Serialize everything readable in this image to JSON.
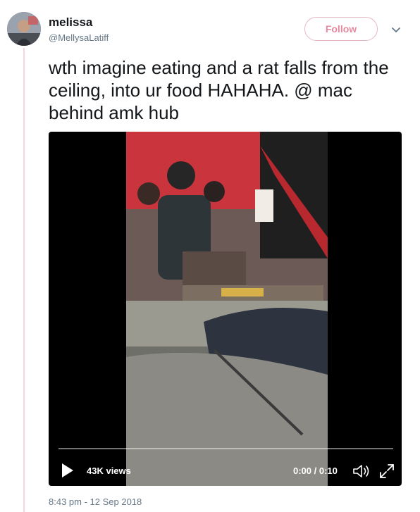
{
  "tweet": {
    "author_name": "melissa",
    "author_handle": "@MellysaLatiff",
    "follow_label": "Follow",
    "text": "wth imagine eating and a rat falls from the ceiling, into ur food HAHAHA. @ mac behind amk hub",
    "timestamp": "8:43 pm - 12 Sep 2018"
  },
  "video": {
    "views": "43K views",
    "time": "0:00 / 0:10",
    "progress": 0
  },
  "icons": {
    "play": "play-icon",
    "volume": "volume-icon",
    "expand": "expand-icon",
    "caret": "chevron-down-icon"
  },
  "colors": {
    "follow_accent": "#e48aa0",
    "thread_line": "#f3d7dc",
    "secondary_text": "#657786"
  }
}
